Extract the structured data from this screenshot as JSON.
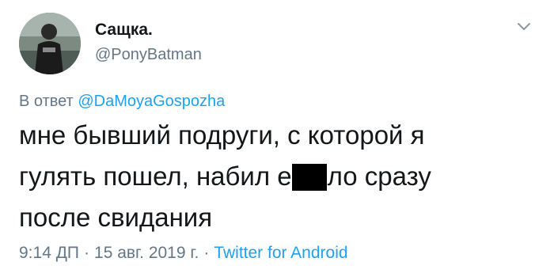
{
  "author": {
    "display_name": "Сащка.",
    "handle": "@PonyBatman",
    "avatar_icon": "user-photo-avatar"
  },
  "menu": {
    "icon": "chevron-down-icon"
  },
  "reply": {
    "prefix": "В ответ",
    "mention": "@DaMoyaGospozha"
  },
  "tweet": {
    "line1": "мне бывший подруги, с которой я",
    "line2_before": "гулять пошел, набил е",
    "line2_after": "ло сразу",
    "line3": "после свидания"
  },
  "meta": {
    "time": "9:14 ДП",
    "date": "15 авг. 2019 г.",
    "source": "Twitter for Android"
  },
  "colors": {
    "accent": "#1da1f2",
    "muted": "#657786",
    "text": "#14171a"
  }
}
